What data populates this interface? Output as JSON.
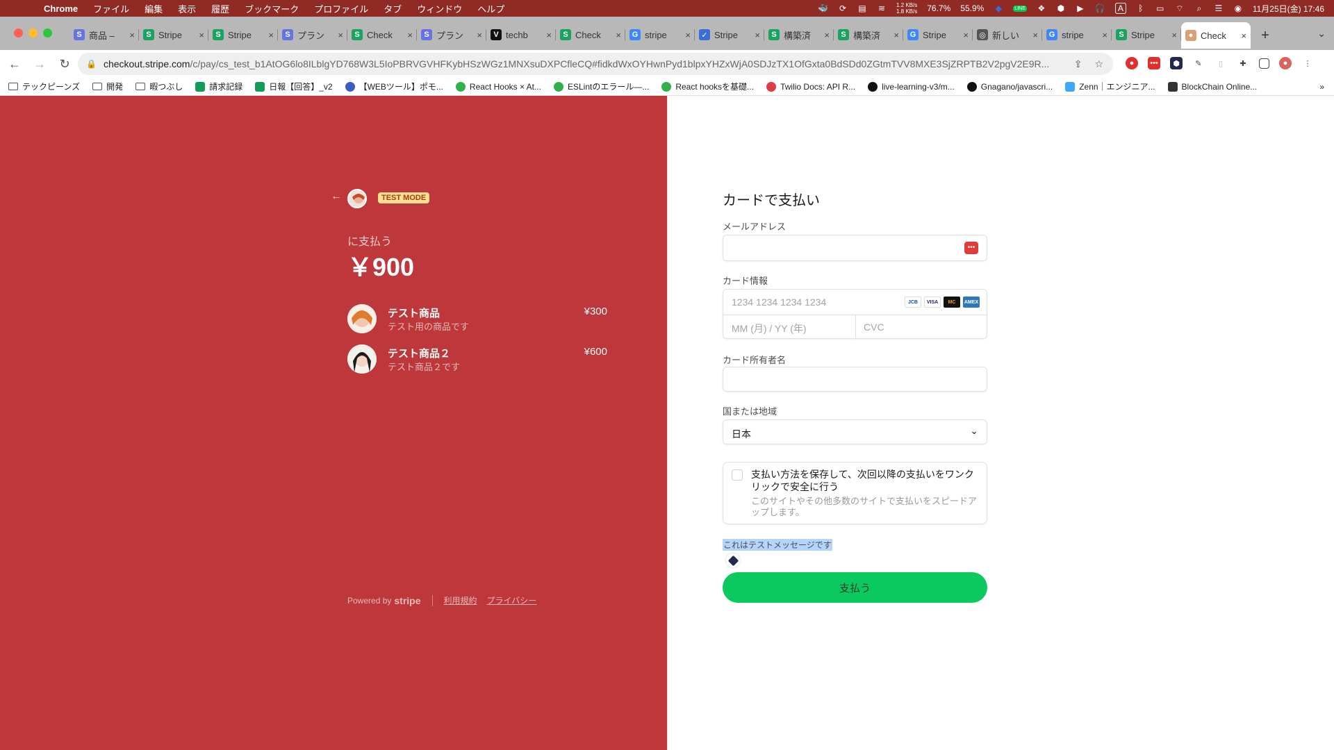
{
  "menubar": {
    "app": "Chrome",
    "items": [
      "ファイル",
      "編集",
      "表示",
      "履歴",
      "ブックマーク",
      "プロファイル",
      "タブ",
      "ウィンドウ",
      "ヘルプ"
    ],
    "net_up": "1.2 KB/s",
    "net_down": "1.8 KB/s",
    "cpu": "76.7%",
    "mem": "55.9%",
    "input_mode": "A",
    "datetime": "11月25日(金) 17:46"
  },
  "tabs": [
    {
      "label": "商品 –",
      "fav": "S",
      "color": "#6772e5"
    },
    {
      "label": "Stripe",
      "fav": "S",
      "color": "#1aa260"
    },
    {
      "label": "Stripe",
      "fav": "S",
      "color": "#1aa260"
    },
    {
      "label": "プラン",
      "fav": "S",
      "color": "#6772e5"
    },
    {
      "label": "Check",
      "fav": "S",
      "color": "#1aa260"
    },
    {
      "label": "プラン",
      "fav": "S",
      "color": "#6772e5"
    },
    {
      "label": "techb",
      "fav": "V",
      "color": "#111111"
    },
    {
      "label": "Check",
      "fav": "S",
      "color": "#1aa260"
    },
    {
      "label": "stripe",
      "fav": "G",
      "color": "#4285f4"
    },
    {
      "label": "Stripe",
      "fav": "✓",
      "color": "#3b6fd8"
    },
    {
      "label": "構築済",
      "fav": "S",
      "color": "#1aa260"
    },
    {
      "label": "構築済",
      "fav": "S",
      "color": "#1aa260"
    },
    {
      "label": "Stripe",
      "fav": "G",
      "color": "#4285f4"
    },
    {
      "label": "新しい",
      "fav": "◎",
      "color": "#555555"
    },
    {
      "label": "stripe",
      "fav": "G",
      "color": "#4285f4"
    },
    {
      "label": "Stripe",
      "fav": "S",
      "color": "#1aa260"
    },
    {
      "label": "Check",
      "fav": "●",
      "color": "#d9a07a"
    }
  ],
  "toolbar": {
    "url_host": "checkout.stripe.com",
    "url_path": "/c/pay/cs_test_b1AtOG6lo8ILblgYD768W3L5IoPBRVGVHFKybHSzWGz1MNXsuDXPCfleCQ#fidkdWxOYHwnPyd1blpxYHZxWjA0SDJzTX1OfGxta0BdSDd0ZGtmTVV8MXE3SjZRPTB2V2pgV2E9R..."
  },
  "bookmarks": [
    {
      "label": "テックピーンズ",
      "icon": "folder"
    },
    {
      "label": "開発",
      "icon": "folder"
    },
    {
      "label": "暇つぶし",
      "icon": "folder"
    },
    {
      "label": "請求記録",
      "icon": "sheet",
      "color": "#0f9d58"
    },
    {
      "label": "日報【回答】_v2",
      "icon": "sheet",
      "color": "#0f9d58"
    },
    {
      "label": "【WEBツール】ポモ...",
      "icon": "circle",
      "color": "#3b5fc0"
    },
    {
      "label": "React Hooks × At...",
      "icon": "circle",
      "color": "#32b14a"
    },
    {
      "label": "ESLintのエラール—...",
      "icon": "circle",
      "color": "#32b14a"
    },
    {
      "label": "React hooksを基礎...",
      "icon": "circle",
      "color": "#32b14a"
    },
    {
      "label": "Twilio Docs: API R...",
      "icon": "circle",
      "color": "#e03a48"
    },
    {
      "label": "live-learning-v3/m...",
      "icon": "github",
      "color": "#111111"
    },
    {
      "label": "Gnagano/javascri...",
      "icon": "github",
      "color": "#111111"
    },
    {
      "label": "Zenn｜エンジニア...",
      "icon": "zenn",
      "color": "#3ea8ff"
    },
    {
      "label": "BlockChain Online...",
      "icon": "square",
      "color": "#333333"
    }
  ],
  "summary": {
    "test_badge": "TEST MODE",
    "pay_to": "に支払う",
    "amount": "￥900",
    "items": [
      {
        "name": "テスト商品",
        "desc": "テスト用の商品です",
        "price": "¥300"
      },
      {
        "name": "テスト商品２",
        "desc": "テスト商品２です",
        "price": "¥600"
      }
    ],
    "powered_by": "Powered by",
    "brand": "stripe",
    "terms": "利用規約",
    "privacy": "プライバシー"
  },
  "form": {
    "title": "カードで支払い",
    "email_label": "メールアドレス",
    "email_value": "",
    "card_label": "カード情報",
    "card_number_placeholder": "1234 1234 1234 1234",
    "expiry_placeholder": "MM (月) / YY (年)",
    "cvc_placeholder": "CVC",
    "brands": [
      "JCB",
      "VISA",
      "MC",
      "AMEX"
    ],
    "holder_label": "カード所有者名",
    "holder_value": "",
    "country_label": "国または地域",
    "country_value": "日本",
    "save_title": "支払い方法を保存して、次回以降の支払いをワンクリックで安全に行う",
    "save_desc": "このサイトやその他多数のサイトで支払いをスピードアップします。",
    "test_message": "これはテストメッセージです",
    "pay_button": "支払う"
  },
  "colors": {
    "left_panel": "#bd373b",
    "pay_button": "#0ac95f",
    "test_badge_bg": "#ffde92",
    "test_badge_text": "#a0410d"
  }
}
